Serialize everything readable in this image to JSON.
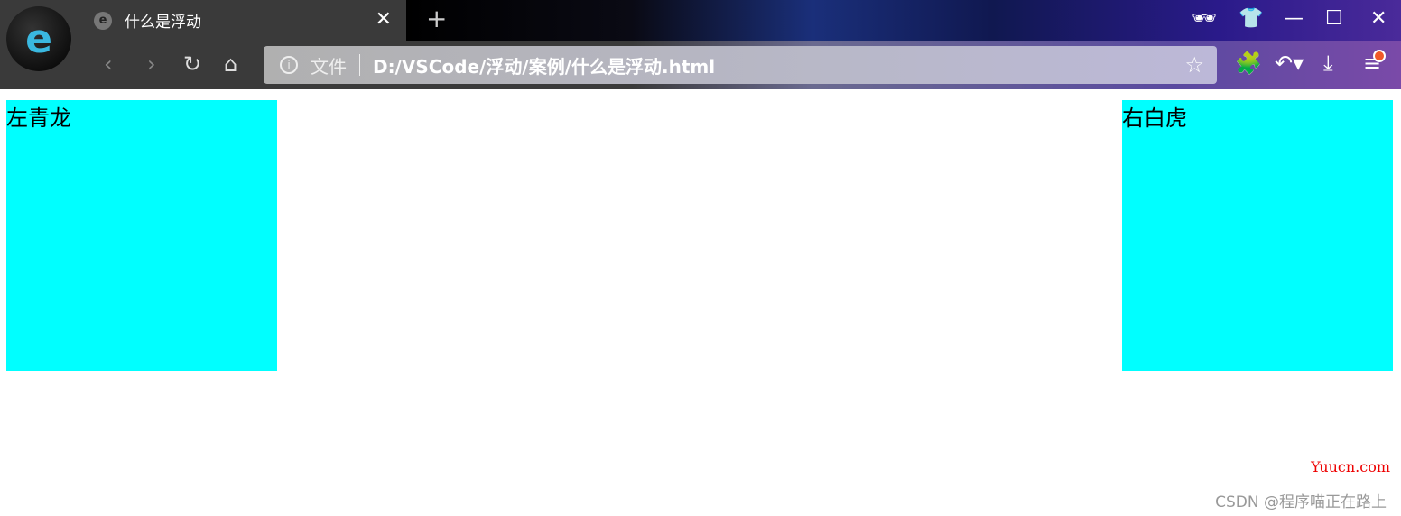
{
  "browser": {
    "tab_title": "什么是浮动",
    "address_label": "文件",
    "url": "D:/VSCode/浮动/案例/什么是浮动.html",
    "icons": [
      "browser-logo-icon",
      "tab-favicon-icon",
      "close-tab-icon",
      "new-tab-icon",
      "incognito-icon",
      "skin-icon",
      "minimize-icon",
      "maximize-icon",
      "close-window-icon",
      "back-icon",
      "forward-icon",
      "reload-icon",
      "home-icon",
      "info-icon",
      "bookmark-star-icon",
      "extensions-icon",
      "undo-icon",
      "download-icon",
      "menu-icon"
    ],
    "notification_color": "#f05a28"
  },
  "page": {
    "left_box": "左青龙",
    "right_box": "右白虎",
    "box_color": "#00ffff"
  },
  "watermark": {
    "site": "Yuucn.com",
    "author": "CSDN @程序喵正在路上"
  }
}
